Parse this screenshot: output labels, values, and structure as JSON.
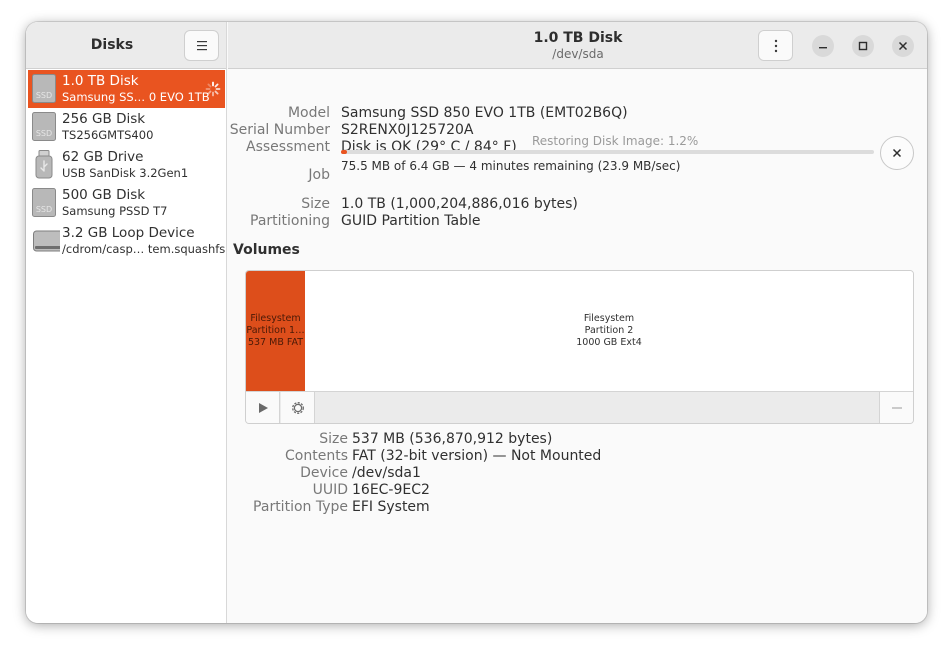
{
  "sidebar": {
    "title": "Disks",
    "disks": [
      {
        "name": "1.0 TB Disk",
        "sub": "Samsung SS… 0 EVO 1TB",
        "icon": "ssd-icon",
        "icon_text": "SSD",
        "selected": true
      },
      {
        "name": "256 GB Disk",
        "sub": "TS256GMTS400",
        "icon": "ssd-icon",
        "icon_text": "SSD"
      },
      {
        "name": "62 GB Drive",
        "sub": "USB SanDisk 3.2Gen1",
        "icon": "usb-drive-icon"
      },
      {
        "name": "500 GB Disk",
        "sub": "Samsung PSSD T7",
        "icon": "ssd-icon",
        "icon_text": "SSD"
      },
      {
        "name": "3.2 GB Loop Device",
        "sub": "/cdrom/casp… tem.squashfs",
        "icon": "loop-device-icon"
      }
    ]
  },
  "header": {
    "title": "1.0 TB Disk",
    "subtitle": "/dev/sda"
  },
  "disk_properties": {
    "model_label": "Model",
    "model": "Samsung SSD 850 EVO 1TB (EMT02B6Q)",
    "serial_label": "Serial Number",
    "serial": "S2RENX0J125720A",
    "assessment_label": "Assessment",
    "assessment": "Disk is OK (29° C / 84° F)",
    "job_label": "Job",
    "job_caption": "Restoring Disk Image: 1.2%",
    "job_progress_percent": 1.2,
    "job_detail": "75.5 MB of 6.4 GB — 4 minutes remaining (23.9 MB/sec)",
    "size_label": "Size",
    "size": "1.0 TB (1,000,204,886,016 bytes)",
    "partitioning_label": "Partitioning",
    "partitioning": "GUID Partition Table"
  },
  "volumes": {
    "title": "Volumes",
    "partitions": [
      {
        "line1": "Filesystem",
        "line2": "Partition 1…",
        "line3": "537 MB FAT",
        "selected": true
      },
      {
        "line1": "Filesystem",
        "line2": "Partition 2",
        "line3": "1000 GB Ext4"
      }
    ]
  },
  "partition_properties": {
    "size_label": "Size",
    "size": "537 MB (536,870,912 bytes)",
    "contents_label": "Contents",
    "contents": "FAT (32-bit version) — Not Mounted",
    "device_label": "Device",
    "device": "/dev/sda1",
    "uuid_label": "UUID",
    "uuid": "16EC-9EC2",
    "type_label": "Partition Type",
    "type": "EFI System"
  },
  "colors": {
    "accent": "#e95420",
    "partition_selected": "#dd4e1b"
  }
}
